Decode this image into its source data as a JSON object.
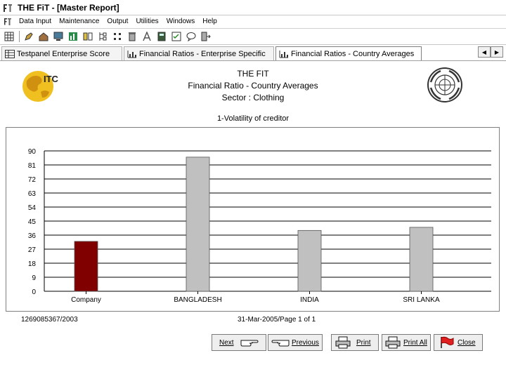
{
  "window": {
    "title": "THE FiT - [Master Report]"
  },
  "menu": [
    "Data Input",
    "Maintenance",
    "Output",
    "Utilities",
    "Windows",
    "Help"
  ],
  "tabs": [
    {
      "label": "Testpanel Enterprise Score",
      "active": false
    },
    {
      "label": "Financial Ratios - Enterprise Specific",
      "active": false
    },
    {
      "label": "Financial Ratios - Country Averages",
      "active": true
    }
  ],
  "report": {
    "title_lines": [
      "THE FIT",
      "Financial Ratio - Country Averages",
      "Sector : Clothing"
    ],
    "logo_text": "ITC",
    "chart_heading": "1-Volatility of creditor",
    "footer_left": "1269085367/2003",
    "footer_mid": "31-Mar-2005/Page 1 of 1"
  },
  "chart_data": {
    "type": "bar",
    "title": "1-Volatility of creditor",
    "categories": [
      "Company",
      "BANGLADESH",
      "INDIA",
      "SRI LANKA"
    ],
    "values": [
      32,
      86,
      39,
      41
    ],
    "bar_colors": [
      "#800000",
      "#c0c0c0",
      "#c0c0c0",
      "#c0c0c0"
    ],
    "yticks": [
      "90",
      "81",
      "72",
      "63",
      "54",
      "45",
      "36",
      "27",
      "18",
      "9",
      "0"
    ],
    "ylim": [
      0,
      90
    ],
    "grid": true
  },
  "buttons": {
    "next": "Next",
    "previous": "Previous",
    "print": "Print",
    "print_all": "Print All",
    "close": "Close"
  }
}
